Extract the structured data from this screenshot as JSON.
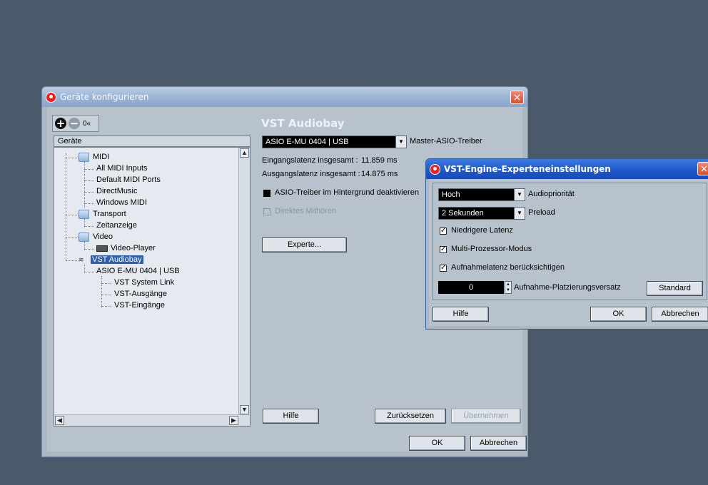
{
  "main_window": {
    "title": "Geräte konfigurieren",
    "close_label": "×",
    "toolbar": {
      "reset_label": "0«"
    },
    "tree": {
      "header": "Geräte",
      "nodes": [
        {
          "label": "MIDI"
        },
        {
          "label": "All MIDI Inputs"
        },
        {
          "label": "Default MIDI Ports"
        },
        {
          "label": "DirectMusic"
        },
        {
          "label": "Windows MIDI"
        },
        {
          "label": "Transport"
        },
        {
          "label": "Zeitanzeige"
        },
        {
          "label": "Video"
        },
        {
          "label": "Video-Player"
        },
        {
          "label": "VST Audiobay"
        },
        {
          "label": "ASIO E-MU 0404 | USB"
        },
        {
          "label": "VST System Link"
        },
        {
          "label": "VST-Ausgänge"
        },
        {
          "label": "VST-Eingänge"
        }
      ]
    },
    "panel": {
      "title": "VST Audiobay",
      "driver_select": "ASIO E-MU 0404 | USB",
      "driver_label": "Master-ASIO-Treiber",
      "input_latency_label": "Eingangslatenz insgesamt :",
      "input_latency_value": "11.859 ms",
      "output_latency_label": "Ausgangslatenz insgesamt :",
      "output_latency_value": "14.875 ms",
      "asio_background_label": "ASIO-Treiber im Hintergrund deaktivieren",
      "direct_monitor_label": "Direktes Mithören",
      "expert_button": "Experte...",
      "help_button": "Hilfe",
      "reset_button": "Zurücksetzen",
      "apply_button": "Übernehmen"
    },
    "ok_button": "OK",
    "cancel_button": "Abbrechen"
  },
  "expert_dialog": {
    "title": "VST-Engine-Experteneinstellungen",
    "close_label": "×",
    "audio_priority_value": "Hoch",
    "audio_priority_label": "Audiopriorität",
    "preload_value": "2 Sekunden",
    "preload_label": "Preload",
    "low_latency_label": "Niedrigere Latenz",
    "multiprocessor_label": "Multi-Prozessor-Modus",
    "record_latency_label": "Aufnahmelatenz berücksichtigen",
    "offset_value": "0",
    "offset_label": "Aufnahme-Platzierungsversatz",
    "standard_button": "Standard",
    "help_button": "Hilfe",
    "ok_button": "OK",
    "cancel_button": "Abbrechen",
    "checks": {
      "low_latency": true,
      "multiprocessor": true,
      "record_latency": true
    }
  },
  "colors": {
    "desktop": "#4a5a6b",
    "selection": "#2f5fa7",
    "close_button": "#d0512e",
    "active_titlebar": "#1f58c9"
  }
}
